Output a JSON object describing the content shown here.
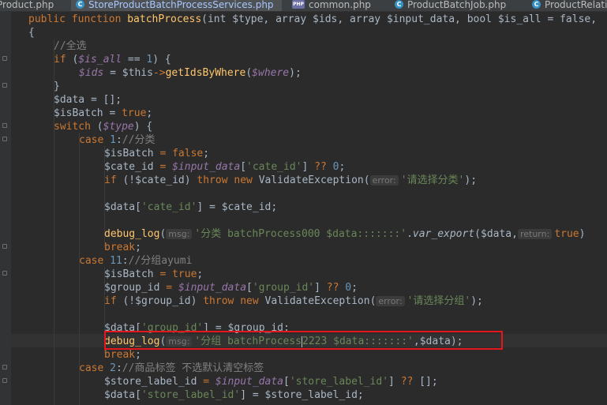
{
  "tabs": [
    {
      "label": "Product.php",
      "active": false,
      "icon": "php-class-icon"
    },
    {
      "label": "StoreProductBatchProcessServices.php",
      "active": true,
      "icon": "php-class-icon"
    },
    {
      "label": "common.php",
      "active": false,
      "icon": "php-file-icon"
    },
    {
      "label": "ProductBatchJob.php",
      "active": false,
      "icon": "php-class-icon"
    },
    {
      "label": "ProductRelatio",
      "active": false,
      "icon": "php-class-icon"
    }
  ],
  "icons": {
    "class_glyph": "C",
    "php_glyph": "PHP"
  },
  "code": {
    "l0": {
      "kw": "public function ",
      "fn": "batchProcess",
      "rest": "(int $type, array $ids, array $input_data, bool $is_all = false,"
    },
    "l1": {
      "text": "{"
    },
    "l2": {
      "comment": "//全选"
    },
    "l3": {
      "kw": "if ",
      "p1": "(",
      "v": "$is_all",
      "op": " == ",
      "num": "1",
      "p2": ") {"
    },
    "l4": {
      "v": "$ids",
      "p1": " = ",
      "p2": "$this",
      "arrow": "->",
      "fn": "getIdsByWhere",
      "p3": "(",
      "v2": "$where",
      "p4": ");"
    },
    "l5": {
      "text": "}"
    },
    "l6": {
      "text": "$data = [];"
    },
    "l7": {
      "p1": "$isBatch = ",
      "kw": "true",
      "p2": ";"
    },
    "l8": {
      "kw": "switch ",
      "p1": "(",
      "v": "$type",
      "p2": ") {"
    },
    "l9": {
      "kw": "case ",
      "num": "1",
      "p1": ":",
      "comment": "//分类"
    },
    "l10": {
      "p1": "$isBatch",
      "op": " = ",
      "kw": "false",
      "p2": ";"
    },
    "l11": {
      "p1": "$cate_id",
      "op": " = ",
      "v": "$input_data",
      "p2": "[",
      "str": "'cate_id'",
      "p3": "] ",
      "op2": "??",
      "num": " 0",
      "p4": ";"
    },
    "l12": {
      "kw": "if ",
      "p1": "(!$cate_id) ",
      "kw2": "throw new ",
      "p2": "ValidateException(",
      "hint": "error:",
      "str": "'请选择分类'",
      "p3": ");"
    },
    "l14": {
      "p1": "$data[",
      "str": "'cate_id'",
      "p2": "] = $cate_id;"
    },
    "l16": {
      "fn": "debug_log",
      "p1": "(",
      "hint": "msg:",
      "str": "'分类 batchProcess000 $data:::::::'",
      "p2": ".",
      "fn2": "var_export",
      "p3": "($data,",
      "hint2": "return:",
      "kw": "true",
      "p4": ")"
    },
    "l17": {
      "kw": "break",
      "p1": ";"
    },
    "l18": {
      "kw": "case ",
      "num": "11",
      "p1": ":",
      "comment": "//分组ayumi"
    },
    "l19": {
      "p1": "$isBatch",
      "op": " = ",
      "kw": "true",
      "p2": ";"
    },
    "l20": {
      "p1": "$group_id",
      "op": " = ",
      "v": "$input_data",
      "p2": "[",
      "str": "'group_id'",
      "p3": "] ",
      "op2": "??",
      "num": " 0",
      "p4": ";"
    },
    "l21": {
      "kw": "if ",
      "p1": "(!$group_id) ",
      "kw2": "throw new ",
      "p2": "ValidateException(",
      "hint": "error:",
      "str": "'请选择分组'",
      "p3": ");"
    },
    "l23": {
      "p1": "$data[",
      "str": "'group_id'",
      "p2": "] = $group_id;"
    },
    "l24": {
      "fn": "debug_log",
      "p1": "(",
      "hint": "msg:",
      "str_a": "'分组 batchProcess",
      "str_b": "2223 $data:::::::'",
      "p2": ",$data);"
    },
    "l25": {
      "kw": "break",
      "p1": ";"
    },
    "l26": {
      "kw": "case ",
      "num": "2",
      "p1": ":",
      "comment": "//商品标签 不选默认清空标签"
    },
    "l27": {
      "p1": "$store_label_id",
      "op": " = ",
      "v": "$input_data",
      "p2": "[",
      "str": "'store_label_id'",
      "p3": "] ",
      "op2": "??",
      "p4": " [];"
    },
    "l28": {
      "p1": "$data[",
      "str": "'store_label_id'",
      "p2": "] = $store_label_id;"
    }
  }
}
